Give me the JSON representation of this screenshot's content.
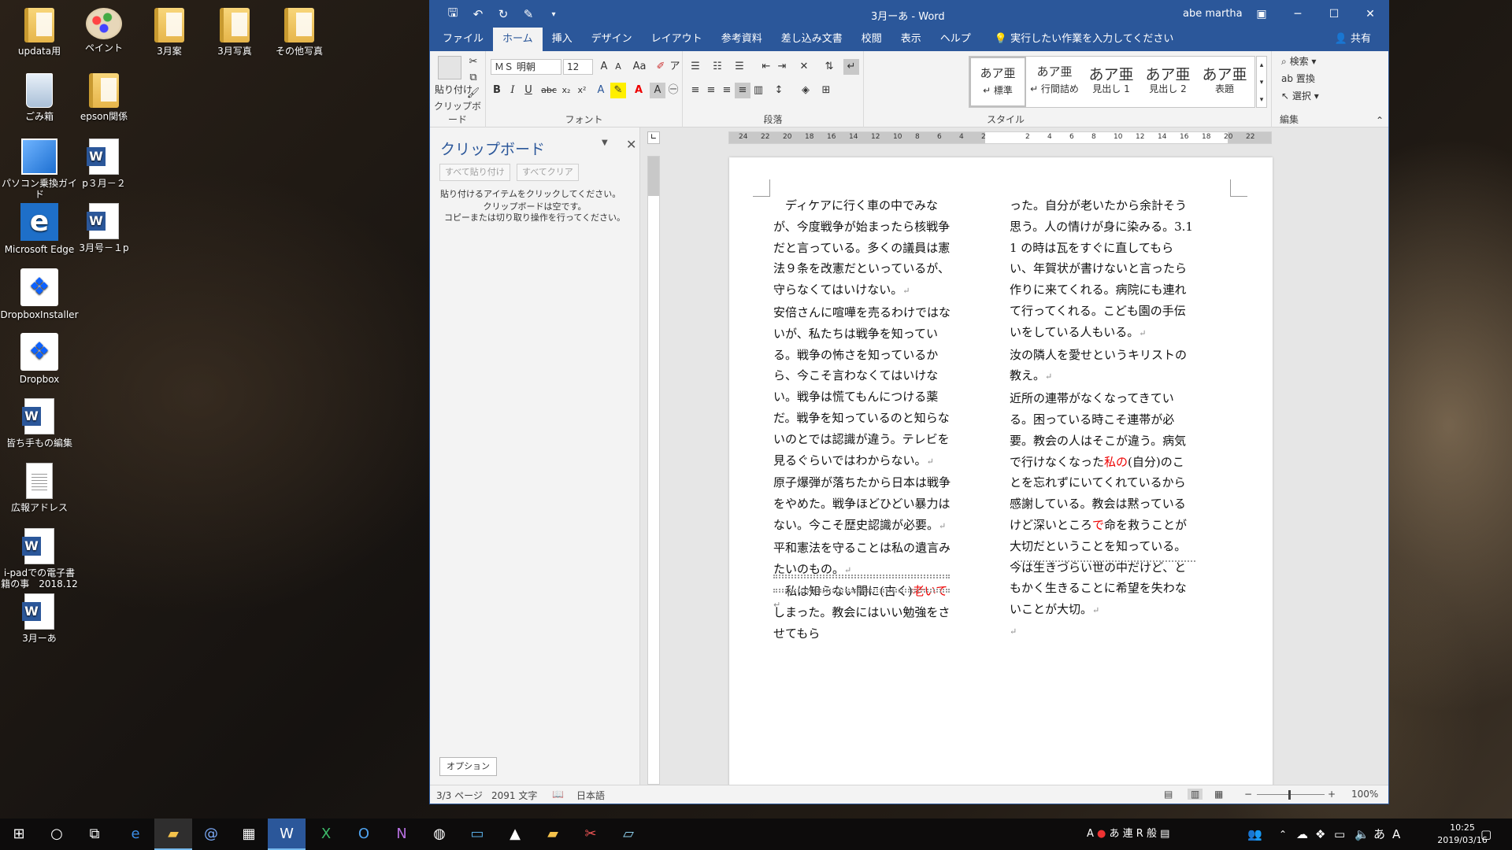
{
  "desktop": {
    "icons": [
      {
        "label": "updata用",
        "icon": "folder-icon"
      },
      {
        "label": "ペイント",
        "icon": "paint-icon"
      },
      {
        "label": "3月案",
        "icon": "folder-icon"
      },
      {
        "label": "3月写真",
        "icon": "folder-icon"
      },
      {
        "label": "その他写真",
        "icon": "folder-icon"
      },
      {
        "label": "ごみ箱",
        "icon": "recycle-bin-icon"
      },
      {
        "label": "epson関係",
        "icon": "folder-icon"
      },
      {
        "label": "パソコン乗換ガイド",
        "icon": "pc-guide-icon"
      },
      {
        "label": "p３月－２",
        "icon": "word-doc-icon"
      },
      {
        "label": "Microsoft Edge",
        "icon": "edge-icon"
      },
      {
        "label": "3月号－１p",
        "icon": "word-doc-icon"
      },
      {
        "label": "DropboxInstaller",
        "icon": "dropbox-icon"
      },
      {
        "label": "Dropbox",
        "icon": "dropbox-icon"
      },
      {
        "label": "皆ち手もの編集",
        "icon": "word-doc-icon"
      },
      {
        "label": "広報アドレス",
        "icon": "text-doc-icon"
      },
      {
        "label": "i-padでの電子書籍の事　2018.12",
        "icon": "word-doc-icon"
      },
      {
        "label": "3月ーあ",
        "icon": "word-doc-icon"
      }
    ]
  },
  "word": {
    "title": "3月ーあ  -  Word",
    "user": "abe martha",
    "tabs": [
      "ファイル",
      "ホーム",
      "挿入",
      "デザイン",
      "レイアウト",
      "参考資料",
      "差し込み文書",
      "校閲",
      "表示",
      "ヘルプ"
    ],
    "active_tab": "ホーム",
    "tell_me": "実行したい作業を入力してください",
    "share": "共有",
    "ribbon": {
      "paste": "貼り付け",
      "clipboard_group": "クリップボード",
      "font_name": "ＭＳ 明朝",
      "font_size": "12",
      "font_group": "フォント",
      "paragraph_group": "段落",
      "styles": [
        {
          "sample": "あア亜",
          "name": "↵ 標準"
        },
        {
          "sample": "あア亜",
          "name": "↵ 行間詰め"
        },
        {
          "sample": "あア亜",
          "name": "見出し 1"
        },
        {
          "sample": "あア亜",
          "name": "見出し 2"
        },
        {
          "sample": "あア亜",
          "name": "表題"
        }
      ],
      "styles_group": "スタイル",
      "find": "検索",
      "replace": "置換",
      "select": "選択",
      "edit_group": "編集"
    },
    "clipboard_pane": {
      "title": "クリップボード",
      "paste_all": "すべて貼り付け",
      "clear_all": "すべてクリア",
      "hint": "貼り付けるアイテムをクリックしてください。",
      "empty_line1": "クリップボードは空です。",
      "empty_line2": "コピーまたは切り取り操作を行ってください。",
      "options": "オプション"
    },
    "ruler_numbers": [
      "24",
      "22",
      "20",
      "18",
      "16",
      "14",
      "12",
      "10",
      "8",
      "6",
      "4",
      "2",
      "",
      "2",
      "4",
      "6",
      "8",
      "10",
      "12",
      "14",
      "16",
      "18",
      "20",
      "22"
    ],
    "document": {
      "left_column": [
        {
          "text": "　ディケアに行く車の中でみなが、今度戦争が始まったら核戦争だと言っている。多くの議員は憲法９条を改憲だといっているが、守らなくてはいけない。"
        },
        {
          "text": "安倍さんに喧嘩を売るわけではないが、私たちは戦争を知っている。戦争の怖さを知っているから、今こそ言わなくてはいけない。戦争は慌てもんにつける薬だ。戦争を知っているのと知らないのとでは認識が違う。テレビを見るぐらいではわからない。"
        },
        {
          "text": "原子爆弾が落ちたから日本は戦争をやめた。戦争ほどひどい暴力はない。今こそ歴史認識が必要。"
        },
        {
          "text": "平和憲法を守ることは私の遺言みたいのもの。"
        }
      ],
      "left_last_pre": "　私は知らない間に(古く)",
      "left_last_red": "老いて",
      "left_last_post": "しまった。教会にはいい勉強をさせてもら",
      "right_column_1": "った。自分が老いたから余計そう思う。人の情けが身に染みる。3.11 の時は瓦をすぐに直してもらい、年賀状が書けないと言ったら作りに来てくれる。病院にも連れて行ってくれる。こども園の手伝いをしている人もいる。",
      "right_column_2": "汝の隣人を愛せというキリストの教え。",
      "right_column_3_pre": "近所の連帯がなくなってきている。困っている時こそ連帯が必要。教会の人はそこが違う。病気で行けなくなった",
      "right_column_3_red": "私の",
      "right_column_3_mid": "(自分)のことを忘れずにいてくれているから感謝している。教会は黙っているけど深いところ",
      "right_column_3_red2": "で",
      "right_column_3_post": "命を救うことが大切だということを知っている。今は生きづらい世の中だけど、ともかく生きることに希望を失わないことが大切。"
    },
    "status": {
      "page": "3/3 ページ",
      "words": "2091 文字",
      "language": "日本語",
      "zoom": "100%"
    }
  },
  "taskbar": {
    "ime": "あ 連 R 般",
    "ime_mode": "あ",
    "time": "10:25",
    "date": "2019/03/16"
  }
}
